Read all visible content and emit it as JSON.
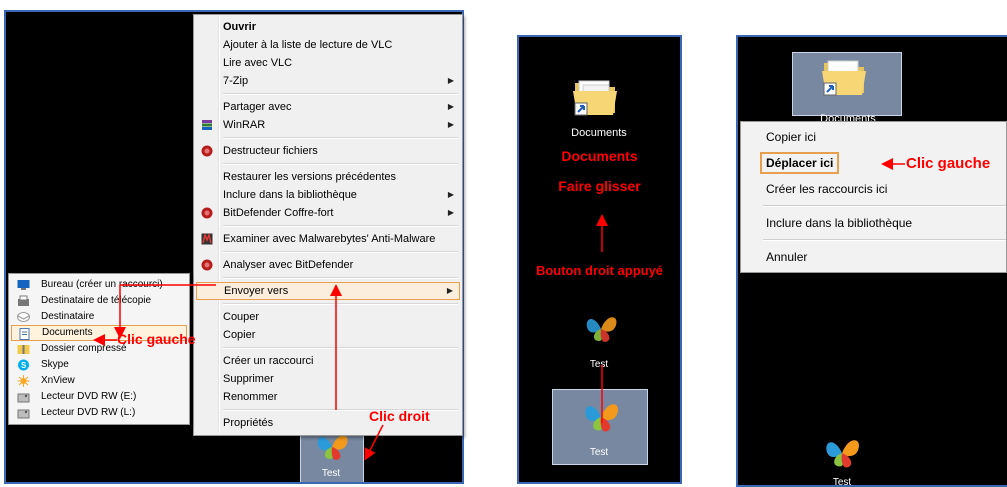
{
  "context_menu": {
    "items": [
      {
        "label": "Ouvrir",
        "bold": true
      },
      {
        "label": "Ajouter à la liste de lecture de VLC"
      },
      {
        "label": "Lire avec VLC"
      },
      {
        "label": "7-Zip",
        "submenu": true
      },
      {
        "sep": true
      },
      {
        "label": "Partager avec",
        "submenu": true
      },
      {
        "label": "WinRAR",
        "submenu": true,
        "icon": "winrar-icon"
      },
      {
        "sep": true
      },
      {
        "label": "Destructeur fichiers",
        "icon": "bitdefender-icon"
      },
      {
        "sep": true
      },
      {
        "label": "Restaurer les versions précédentes"
      },
      {
        "label": "Inclure dans la bibliothèque",
        "submenu": true
      },
      {
        "label": "BitDefender Coffre-fort",
        "submenu": true,
        "icon": "bitdefender-icon"
      },
      {
        "sep": true
      },
      {
        "label": "Examiner avec Malwarebytes' Anti-Malware",
        "icon": "malwarebytes-icon"
      },
      {
        "sep": true
      },
      {
        "label": "Analyser avec BitDefender",
        "icon": "bitdefender-icon"
      },
      {
        "sep": true
      },
      {
        "label": "Envoyer vers",
        "submenu": true,
        "highlighted": true
      },
      {
        "sep": true
      },
      {
        "label": "Couper"
      },
      {
        "label": "Copier"
      },
      {
        "sep": true
      },
      {
        "label": "Créer un raccourci"
      },
      {
        "label": "Supprimer"
      },
      {
        "label": "Renommer"
      },
      {
        "sep": true
      },
      {
        "label": "Propriétés"
      }
    ]
  },
  "send_to_submenu": {
    "items": [
      {
        "label": "Bureau (créer un raccourci)",
        "icon": "desktop-icon"
      },
      {
        "label": "Destinataire de télécopie",
        "icon": "fax-icon"
      },
      {
        "label": "Destinataire",
        "icon": "mail-icon"
      },
      {
        "label": "Documents",
        "icon": "document-icon",
        "highlighted": true
      },
      {
        "label": "Dossier compressé",
        "icon": "zip-folder-icon"
      },
      {
        "label": "Skype",
        "icon": "skype-icon"
      },
      {
        "label": "XnView",
        "icon": "xnview-icon"
      },
      {
        "label": "Lecteur DVD RW (E:)",
        "icon": "dvd-drive-icon"
      },
      {
        "label": "Lecteur DVD RW (L:)",
        "icon": "dvd-drive-icon"
      }
    ]
  },
  "annotations": {
    "clic_droit": "Clic droit",
    "clic_gauche": "Clic gauche",
    "documents": "Documents",
    "faire_glisser": "Faire glisser",
    "bouton_droit": "Bouton droit appuyé",
    "clic_gauche_2": "Clic gauche"
  },
  "desktop_icons": {
    "test_label": "Test",
    "documents_label": "Documents",
    "documents_partial": "Documents"
  },
  "drag_menu": {
    "items": [
      {
        "label": "Copier ici"
      },
      {
        "label": "Déplacer ici",
        "bold": true,
        "highlighted": true
      },
      {
        "label": "Créer les raccourcis ici"
      },
      {
        "sep": true
      },
      {
        "label": "Inclure dans la bibliothèque"
      },
      {
        "sep": true
      },
      {
        "label": "Annuler"
      }
    ]
  },
  "colors": {
    "annotation_red": "#ff0000",
    "panel_border": "#3a68b4",
    "highlight_border": "#e8a04e"
  }
}
